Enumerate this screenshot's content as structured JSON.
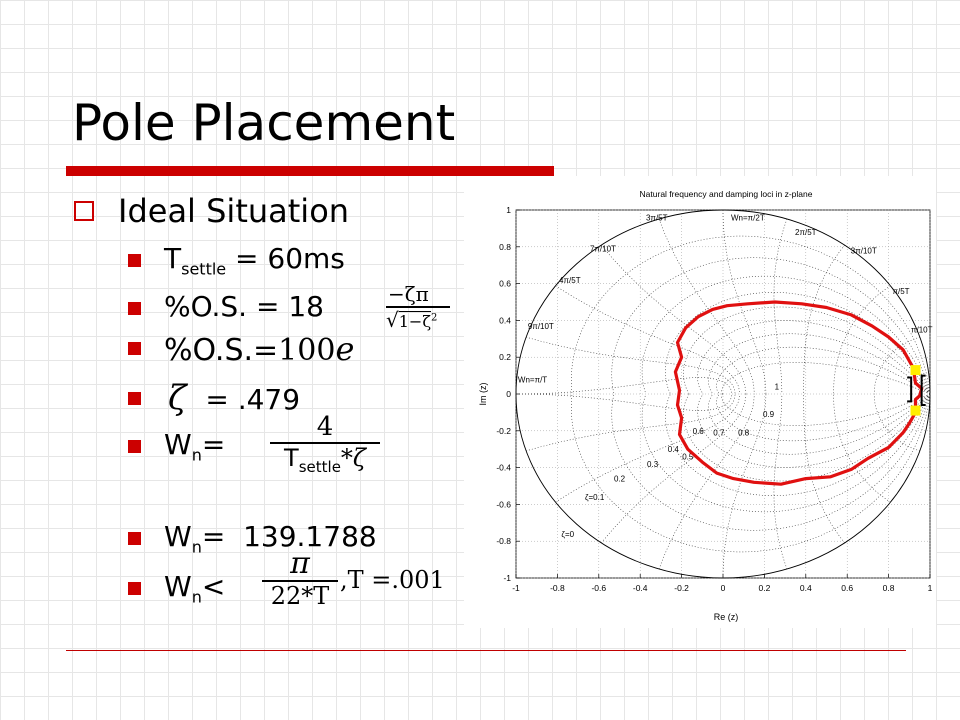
{
  "slide": {
    "title": "Pole Placement",
    "heading": "Ideal Situation",
    "bullets": {
      "tsettle": {
        "main": "T",
        "sub": "settle",
        "rest": " = 60ms"
      },
      "os": "%O.S. = 18",
      "os_formula": {
        "lhs": "%O.S.",
        "eq": "=100",
        "e": "e",
        "exp_num": "−ζπ",
        "exp_den": "1−ζ",
        "exp_den_pow": "2"
      },
      "zeta": {
        "symbol": "ζ",
        "rest": " = .479"
      },
      "wn_def": {
        "main": "W",
        "sub": "n",
        "rest": "=",
        "num": "4",
        "den_main": "T",
        "den_sub": "settle",
        "den_rest": "*ζ"
      },
      "wn_val": {
        "main": "W",
        "sub": "n",
        "rest": "=  139.1788"
      },
      "wn_lim": {
        "main": "W",
        "sub": "n",
        "rest": "<",
        "num": "π",
        "den": "22*T",
        "tail": ",T =.001"
      }
    }
  },
  "chart_data": {
    "type": "line",
    "title": "Natural frequency and damping loci in z-plane",
    "xlabel": "Re (z)",
    "ylabel": "Im (z)",
    "xlim": [
      -1,
      1
    ],
    "ylim": [
      -1,
      1
    ],
    "xticks": [
      "-1",
      "-0.8",
      "-0.6",
      "-0.4",
      "-0.2",
      "0",
      "0.2",
      "0.4",
      "0.6",
      "0.8",
      "1"
    ],
    "yticks": [
      "1",
      "0.8",
      "0.6",
      "0.4",
      "0.2",
      "0",
      "-0.2",
      "-0.4",
      "-0.6",
      "-0.8",
      "-1"
    ],
    "zeta_labels": [
      "ζ=0",
      "ζ=0.1",
      "0.2",
      "0.3",
      "0.4",
      "0.5",
      "0.6",
      "0.7",
      "0.8",
      "0.9",
      "1"
    ],
    "wn_labels": [
      "Wn=π/2T",
      "2π/5T",
      "3π/10T",
      "π/5T",
      "π/10T",
      "3π/5T",
      "7π/10T",
      "4π/5T",
      "9π/10T",
      "Wn=π/T"
    ],
    "series": [
      {
        "color": "#e01010",
        "points": [
          [
            0.9,
            0.18
          ],
          [
            0.87,
            0.24
          ],
          [
            0.8,
            0.31
          ],
          [
            0.72,
            0.37
          ],
          [
            0.62,
            0.43
          ],
          [
            0.5,
            0.47
          ],
          [
            0.38,
            0.49
          ],
          [
            0.25,
            0.5
          ],
          [
            0.12,
            0.49
          ],
          [
            0.02,
            0.48
          ],
          [
            -0.05,
            0.46
          ],
          [
            -0.12,
            0.42
          ],
          [
            -0.18,
            0.36
          ],
          [
            -0.22,
            0.28
          ],
          [
            -0.2,
            0.2
          ],
          [
            -0.23,
            0.12
          ],
          [
            -0.21,
            0.02
          ],
          [
            -0.22,
            -0.06
          ],
          [
            -0.2,
            -0.13
          ],
          [
            -0.21,
            -0.22
          ],
          [
            -0.17,
            -0.3
          ],
          [
            -0.1,
            -0.37
          ],
          [
            -0.03,
            -0.43
          ],
          [
            0.05,
            -0.46
          ],
          [
            0.15,
            -0.48
          ],
          [
            0.28,
            -0.49
          ],
          [
            0.4,
            -0.46
          ],
          [
            0.52,
            -0.45
          ],
          [
            0.62,
            -0.41
          ],
          [
            0.7,
            -0.35
          ],
          [
            0.8,
            -0.29
          ],
          [
            0.87,
            -0.21
          ],
          [
            0.9,
            -0.16
          ],
          [
            0.93,
            -0.1
          ],
          [
            0.93,
            -0.03
          ],
          [
            0.95,
            -0.01
          ],
          [
            0.96,
            0.03
          ],
          [
            0.93,
            0.06
          ],
          [
            0.92,
            0.14
          ],
          [
            0.9,
            0.18
          ]
        ]
      }
    ],
    "markers": [
      {
        "x": 0.93,
        "y": 0.13,
        "color": "#ffee00"
      },
      {
        "x": 0.93,
        "y": -0.09,
        "color": "#ffee00"
      }
    ]
  }
}
